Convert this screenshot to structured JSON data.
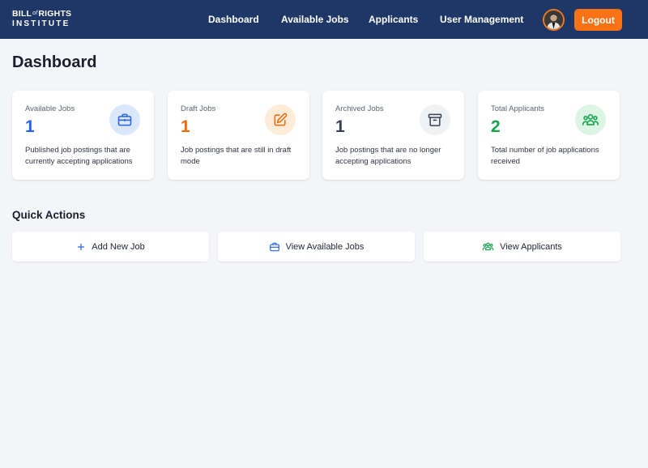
{
  "brand": {
    "line1_left": "BILL",
    "line1_mid": "of",
    "line1_right": "RIGHTS",
    "line2": "INSTITUTE"
  },
  "nav": {
    "links": [
      "Dashboard",
      "Available Jobs",
      "Applicants",
      "User Management"
    ],
    "logout_label": "Logout"
  },
  "page": {
    "title": "Dashboard"
  },
  "stats": [
    {
      "label": "Available Jobs",
      "value": "1",
      "description": "Published job postings that are currently accepting applications",
      "icon": "briefcase-icon",
      "accent": "#2563eb",
      "icon_bg": "#dbe7fb"
    },
    {
      "label": "Draft Jobs",
      "value": "1",
      "description": "Job postings that are still in draft mode",
      "icon": "edit-icon",
      "accent": "#ea6a0c",
      "icon_bg": "#fdecd8"
    },
    {
      "label": "Archived Jobs",
      "value": "1",
      "description": "Job postings that are no longer accepting applications",
      "icon": "archive-icon",
      "accent": "#374151",
      "icon_bg": "#f0f1f3"
    },
    {
      "label": "Total Applicants",
      "value": "2",
      "description": "Total number of job applications received",
      "icon": "users-icon",
      "accent": "#16a34a",
      "icon_bg": "#dcf5e4"
    }
  ],
  "quick_actions": {
    "title": "Quick Actions",
    "buttons": [
      {
        "label": "Add New Job",
        "icon": "plus-icon",
        "icon_color": "#2563eb"
      },
      {
        "label": "View Available Jobs",
        "icon": "briefcase-icon",
        "icon_color": "#2563eb"
      },
      {
        "label": "View Applicants",
        "icon": "users-icon",
        "icon_color": "#16a34a"
      }
    ]
  }
}
